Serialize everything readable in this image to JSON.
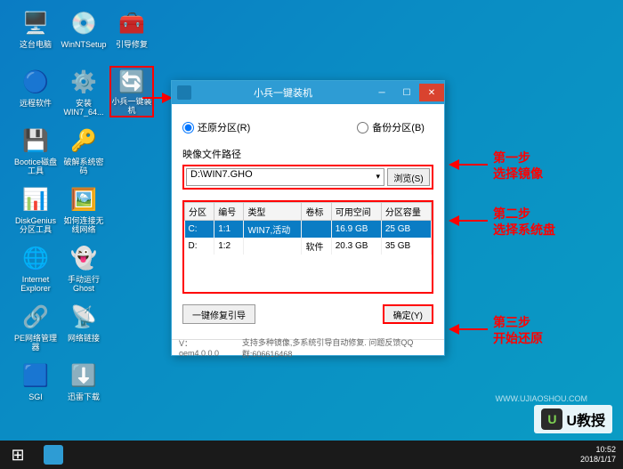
{
  "desktop_icons": [
    {
      "row": 0,
      "col": 0,
      "label": "这台电脑",
      "glyph": "🖥️"
    },
    {
      "row": 0,
      "col": 1,
      "label": "WinNTSetup",
      "glyph": "💿"
    },
    {
      "row": 0,
      "col": 2,
      "label": "引导修复",
      "glyph": "🧰"
    },
    {
      "row": 1,
      "col": 0,
      "label": "远程软件",
      "glyph": "🔵"
    },
    {
      "row": 1,
      "col": 1,
      "label": "安装WIN7_64...",
      "glyph": "⚙️"
    },
    {
      "row": 1,
      "col": 2,
      "label": "小兵一键装机",
      "glyph": "🔄",
      "highlight": true
    },
    {
      "row": 2,
      "col": 0,
      "label": "Bootice磁盘工具",
      "glyph": "💾"
    },
    {
      "row": 2,
      "col": 1,
      "label": "破解系统密码",
      "glyph": "🔑"
    },
    {
      "row": 3,
      "col": 0,
      "label": "DiskGenius分区工具",
      "glyph": "📊"
    },
    {
      "row": 3,
      "col": 1,
      "label": "如何连接无线网络",
      "glyph": "🖼️"
    },
    {
      "row": 4,
      "col": 0,
      "label": "Internet Explorer",
      "glyph": "🌐"
    },
    {
      "row": 4,
      "col": 1,
      "label": "手动运行Ghost",
      "glyph": "👻"
    },
    {
      "row": 5,
      "col": 0,
      "label": "PE网络管理器",
      "glyph": "🔗"
    },
    {
      "row": 5,
      "col": 1,
      "label": "网络链接",
      "glyph": "📡"
    },
    {
      "row": 6,
      "col": 0,
      "label": "SGI",
      "glyph": "🟦"
    },
    {
      "row": 6,
      "col": 1,
      "label": "迅雷下载",
      "glyph": "⬇️"
    }
  ],
  "window": {
    "title": "小兵一键装机",
    "radio_restore": "还原分区(R)",
    "radio_backup": "备份分区(B)",
    "image_path_label": "映像文件路径",
    "image_path": "D:\\WIN7.GHO",
    "browse_btn": "浏览(S)",
    "table_headers": [
      "分区",
      "编号",
      "类型",
      "卷标",
      "可用空间",
      "分区容量"
    ],
    "table_rows": [
      {
        "part": "C:",
        "num": "1:1",
        "type": "WIN7,活动",
        "label": "",
        "free": "16.9 GB",
        "size": "25 GB",
        "selected": true
      },
      {
        "part": "D:",
        "num": "1:2",
        "type": "",
        "label": "软件",
        "free": "20.3 GB",
        "size": "35 GB",
        "selected": false
      }
    ],
    "repair_btn": "一键修复引导",
    "ok_btn": "确定(Y)",
    "status_version": "V：oem4.0.0.0",
    "status_text": "支持多种镜像,多系统引导自动修复. 问题反馈QQ群:606616468"
  },
  "annotations": {
    "step1_title": "第一步",
    "step1_desc": "选择镜像",
    "step2_title": "第二步",
    "step2_desc": "选择系统盘",
    "step3_title": "第三步",
    "step3_desc": "开始还原"
  },
  "taskbar": {
    "time": "10:52",
    "date": "2018/1/17"
  },
  "watermark": {
    "text": "U教授",
    "url": "WWW.UJIAOSHOU.COM"
  }
}
